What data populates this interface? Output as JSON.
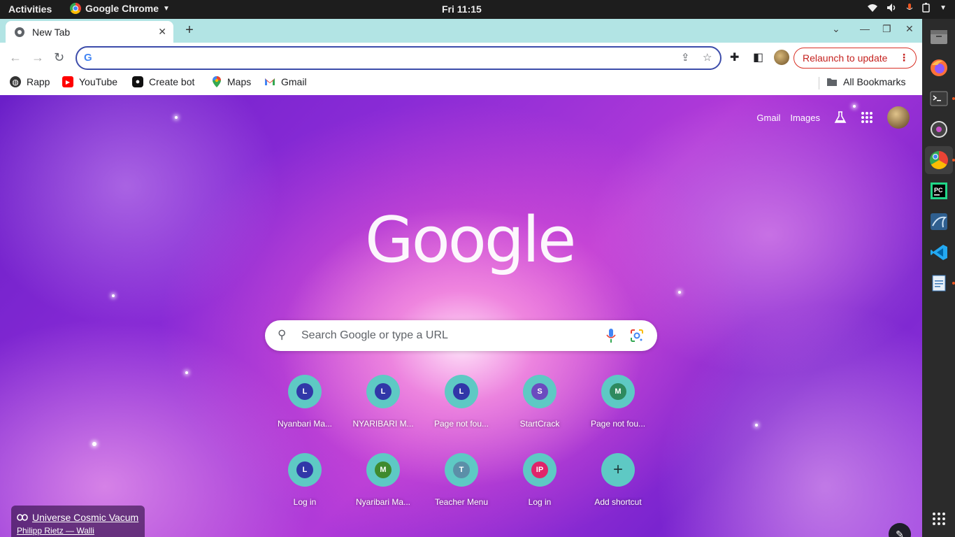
{
  "topbar": {
    "activities": "Activities",
    "app_name": "Google Chrome",
    "clock": "Fri 11:15"
  },
  "tabs": [
    {
      "title": "New Tab"
    }
  ],
  "omnibox": {
    "value": "",
    "placeholder": ""
  },
  "toolbar": {
    "relaunch_label": "Relaunch to update"
  },
  "bookmarks": {
    "items": [
      {
        "label": "Rapp",
        "icon": "globe-icon"
      },
      {
        "label": "YouTube",
        "icon": "youtube-icon"
      },
      {
        "label": "Create bot",
        "icon": "bot-icon"
      },
      {
        "label": "Maps",
        "icon": "maps-icon"
      },
      {
        "label": "Gmail",
        "icon": "gmail-icon"
      }
    ],
    "all_bookmarks": "All Bookmarks"
  },
  "ntp": {
    "gmail_link": "Gmail",
    "images_link": "Images",
    "logo_text": "Google",
    "search_placeholder": "Search Google or type a URL",
    "shortcuts_row1": [
      {
        "letter": "L",
        "color": "#3137a8",
        "label": "Nyanbari Ma..."
      },
      {
        "letter": "L",
        "color": "#3137a8",
        "label": "NYARIBARI M..."
      },
      {
        "letter": "L",
        "color": "#3137a8",
        "label": "Page not fou..."
      },
      {
        "letter": "S",
        "color": "#6b4bbf",
        "label": "StartCrack"
      },
      {
        "letter": "M",
        "color": "#2e8a5e",
        "label": "Page not fou..."
      }
    ],
    "shortcuts_row2": [
      {
        "letter": "L",
        "color": "#3137a8",
        "label": "Log in"
      },
      {
        "letter": "M",
        "color": "#3f8a2e",
        "label": "Nyaribari Ma..."
      },
      {
        "letter": "T",
        "color": "#5b8fa8",
        "label": "Teacher Menu"
      },
      {
        "letter": "IP",
        "color": "#e0246a",
        "label": "Log in"
      },
      {
        "letter": "+",
        "color": "",
        "label": "Add shortcut"
      }
    ],
    "attribution_title": "Universe Cosmic Vacum",
    "attribution_author": "Philipp Rietz — Walli"
  }
}
